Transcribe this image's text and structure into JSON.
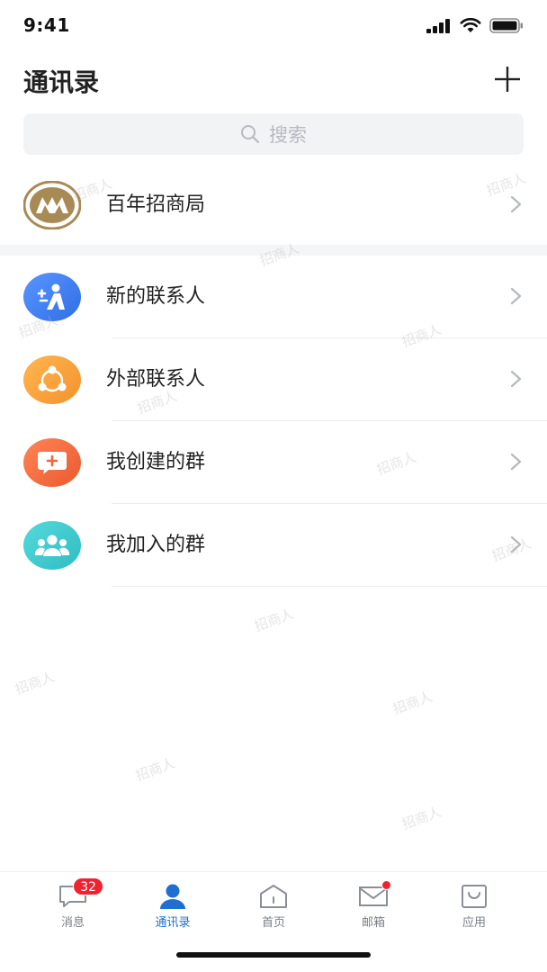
{
  "status_bar": {
    "time": "9:41"
  },
  "header": {
    "title": "通讯录"
  },
  "search": {
    "placeholder": "搜索"
  },
  "org": {
    "name": "百年招商局"
  },
  "contacts": {
    "items": [
      {
        "label": "新的联系人",
        "color": "#3f7df0"
      },
      {
        "label": "外部联系人",
        "color": "#f7a13b"
      },
      {
        "label": "我创建的群",
        "color": "#f06a3d"
      },
      {
        "label": "我加入的群",
        "color": "#3fc9cd"
      }
    ]
  },
  "watermark": {
    "text": "招商人"
  },
  "tabs": [
    {
      "label": "消息",
      "badge": "32"
    },
    {
      "label": "通讯录"
    },
    {
      "label": "首页"
    },
    {
      "label": "邮箱"
    },
    {
      "label": "应用"
    }
  ],
  "colors": {
    "accent": "#1f6fd1",
    "badge": "#f0222f",
    "org_gold": "#a88a55"
  }
}
